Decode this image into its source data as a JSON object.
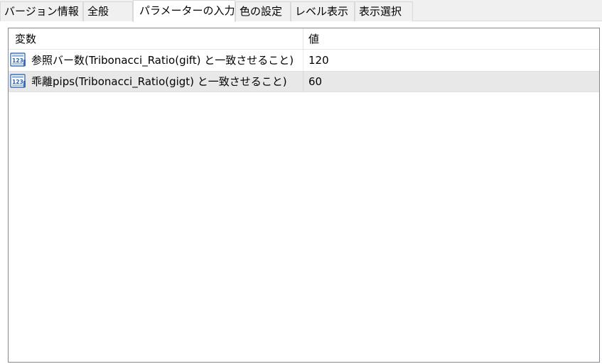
{
  "tabs": [
    {
      "label": "バージョン情報",
      "active": false
    },
    {
      "label": "全般",
      "active": false
    },
    {
      "label": "パラメーターの入力",
      "active": true
    },
    {
      "label": "色の設定",
      "active": false
    },
    {
      "label": "レベル表示",
      "active": false
    },
    {
      "label": "表示選択",
      "active": false
    }
  ],
  "table": {
    "columns": [
      "変数",
      "値"
    ],
    "rows": [
      {
        "icon": "numeric-123-icon",
        "name": "参照バー数(Tribonacci_Ratio(gift) と一致させること)",
        "value": "120",
        "selected": false
      },
      {
        "icon": "numeric-123-icon",
        "name": "乖離pips(Tribonacci_Ratio(gigt) と一致させること)",
        "value": "60",
        "selected": true
      }
    ]
  },
  "colors": {
    "tab_bg": "#f0f0f0",
    "active_tab_bg": "#ffffff",
    "selected_row_bg": "#e8e8e8",
    "icon_blue": "#3d6fb6",
    "border": "#828790"
  }
}
